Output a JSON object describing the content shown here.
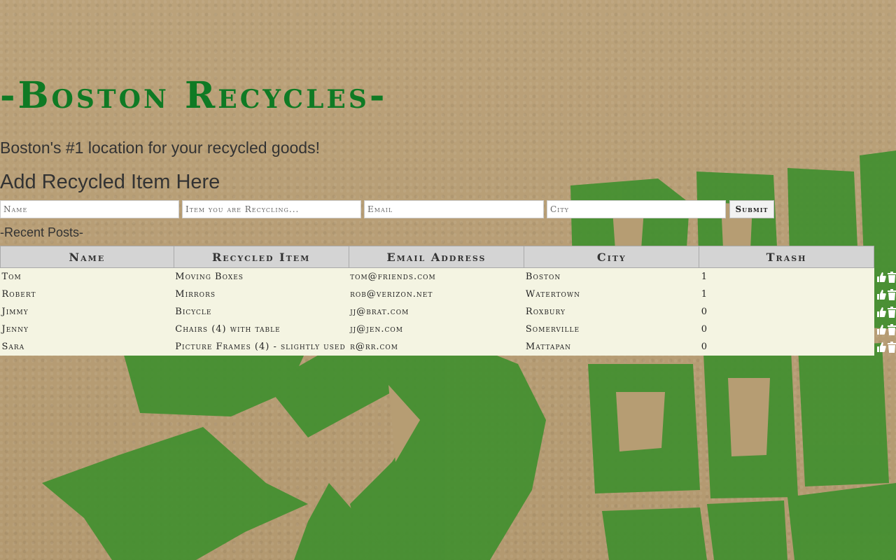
{
  "header": {
    "title": "-Boston Recycles-",
    "tagline": "Boston's #1 location for your recycled goods!"
  },
  "form": {
    "heading": "Add Recycled Item Here",
    "name_placeholder": "Name",
    "item_placeholder": "Item you are Recycling...",
    "email_placeholder": "Email",
    "city_placeholder": "City",
    "submit_label": "Submit"
  },
  "posts": {
    "label": "-Recent Posts-",
    "columns": [
      "Name",
      "Recycled Item",
      "Email Address",
      "City",
      "Trash"
    ],
    "rows": [
      {
        "name": "Tom",
        "item": "Moving Boxes",
        "email": "tom@friends.com",
        "city": "Boston",
        "trash": "1"
      },
      {
        "name": "Robert",
        "item": "Mirrors",
        "email": "rob@verizon.net",
        "city": "Watertown",
        "trash": "1"
      },
      {
        "name": "Jimmy",
        "item": "Bicycle",
        "email": "jj@brat.com",
        "city": "Roxbury",
        "trash": "0"
      },
      {
        "name": "Jenny",
        "item": "Chairs (4) with table",
        "email": "jj@jen.com",
        "city": "Somerville",
        "trash": "0"
      },
      {
        "name": "Sara",
        "item": "Picture Frames (4) - slightly used",
        "email": "r@rr.com",
        "city": "Mattapan",
        "trash": "0"
      }
    ]
  },
  "icons": {
    "upvote": "thumbs-up-icon",
    "delete": "trash-icon"
  },
  "colors": {
    "title": "#0f7a24",
    "background": "#b69d73",
    "art_green": "#3f8f2e",
    "table_bg": "#f4f4e2",
    "header_bg": "#d4d4d4"
  }
}
